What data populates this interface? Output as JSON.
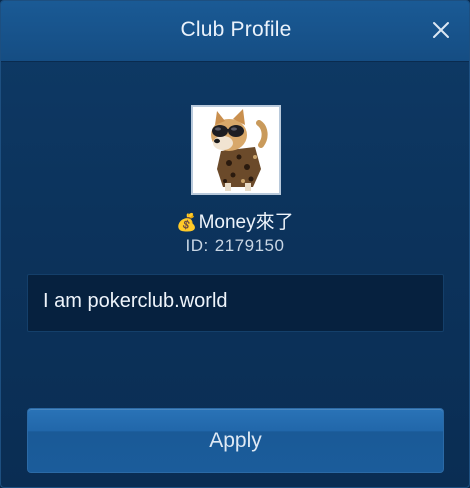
{
  "dialog": {
    "title": "Club Profile",
    "close_icon": "close-icon"
  },
  "profile": {
    "avatar_icon": "dog-with-sunglasses-avatar",
    "money_icon": "money-bag-icon",
    "money_glyph": "💰",
    "name": "Money來了",
    "id_label": "ID:",
    "id_value": "2179150",
    "description": "I am pokerclub.world"
  },
  "actions": {
    "apply_label": "Apply"
  },
  "colors": {
    "header": "#1a5a95",
    "body": "#0c335c",
    "input_bg": "#06213f",
    "button": "#2167aa",
    "text": "#eef4fb"
  }
}
